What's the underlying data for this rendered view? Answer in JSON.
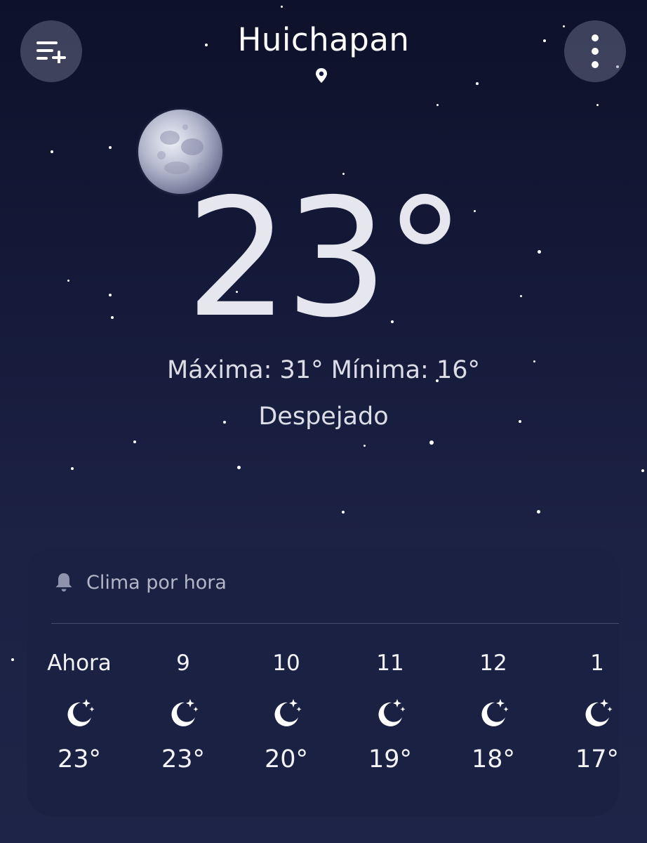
{
  "header": {
    "city": "Huichapan",
    "add_icon": "list-add-icon",
    "menu_icon": "more-vertical-icon",
    "location_icon": "location-pin-icon"
  },
  "current": {
    "temperature": "23°",
    "high_low": "Máxima: 31° Mínima: 16°",
    "condition": "Despejado",
    "icon": "full-moon-illustration"
  },
  "hourly": {
    "title": "Clima por hora",
    "title_icon": "bell-icon",
    "items": [
      {
        "time": "Ahora",
        "temp": "23°",
        "icon": "moon-stars-icon"
      },
      {
        "time": "9",
        "temp": "23°",
        "icon": "moon-stars-icon"
      },
      {
        "time": "10",
        "temp": "20°",
        "icon": "moon-stars-icon"
      },
      {
        "time": "11",
        "temp": "19°",
        "icon": "moon-stars-icon"
      },
      {
        "time": "12",
        "temp": "18°",
        "icon": "moon-stars-icon"
      },
      {
        "time": "1",
        "temp": "17°",
        "icon": "moon-stars-icon"
      }
    ]
  },
  "colors": {
    "background_top": "#0d1129",
    "background_bottom": "#1e2447",
    "card": "#1b2142"
  }
}
